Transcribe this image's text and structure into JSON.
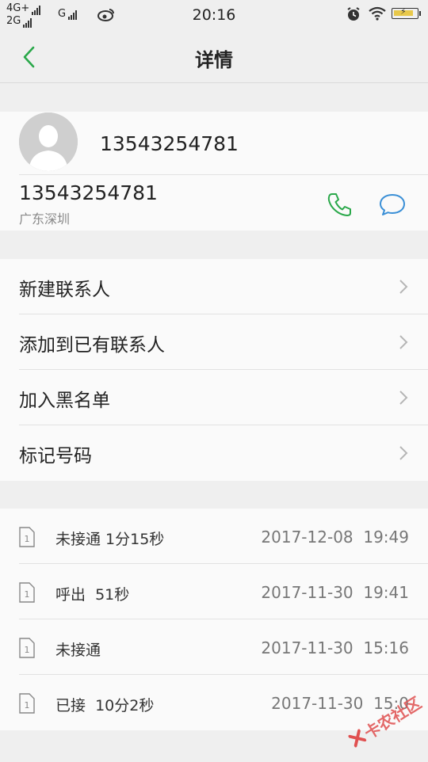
{
  "status_bar": {
    "network_top": "4G+",
    "network_bottom": "2G",
    "network_extra": "G",
    "time": "20:16",
    "icons": [
      "signal-icon",
      "weibo-icon",
      "alarm-icon",
      "wifi-icon",
      "battery-charging-icon"
    ]
  },
  "header": {
    "title": "详情",
    "back_icon": "chevron-left-icon"
  },
  "contact": {
    "name": "13543254781",
    "number": "13543254781",
    "location": "广东深圳",
    "call_icon": "phone-icon",
    "message_icon": "message-icon"
  },
  "actions": [
    {
      "label": "新建联系人"
    },
    {
      "label": "添加到已有联系人"
    },
    {
      "label": "加入黑名单"
    },
    {
      "label": "标记号码"
    }
  ],
  "call_log": [
    {
      "sim": "1",
      "description": "未接通 1分15秒",
      "datetime": "2017-12-08  19:49"
    },
    {
      "sim": "1",
      "description": "呼出  51秒",
      "datetime": "2017-11-30  19:41"
    },
    {
      "sim": "1",
      "description": "未接通",
      "datetime": "2017-11-30  15:16"
    },
    {
      "sim": "1",
      "description": "已接  10分2秒",
      "datetime": "2017-11-30  15:0"
    }
  ],
  "watermark": {
    "text": "卡农社区"
  },
  "colors": {
    "accent_green": "#2aa84a",
    "accent_blue": "#3a8fd6",
    "background": "#efefef",
    "card": "#fafafa"
  }
}
